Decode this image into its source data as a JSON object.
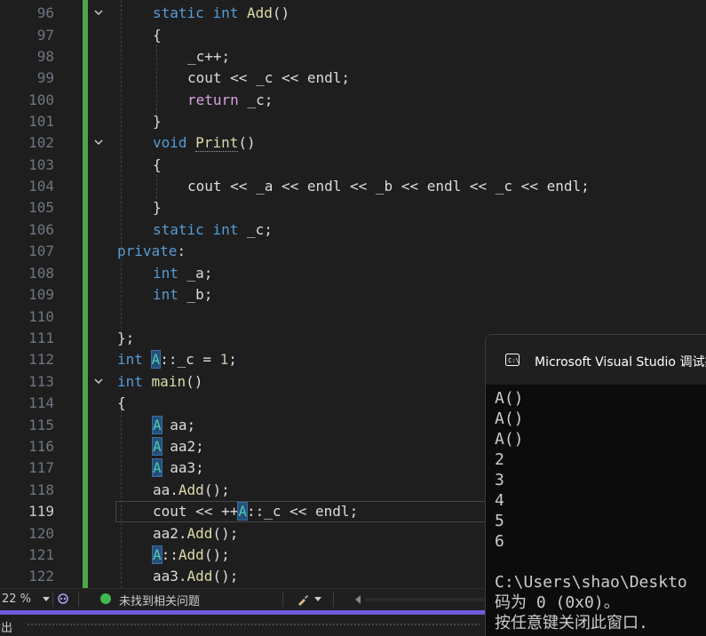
{
  "editor": {
    "lines": [
      {
        "n": "96"
      },
      {
        "n": "97"
      },
      {
        "n": "98"
      },
      {
        "n": "99"
      },
      {
        "n": "100"
      },
      {
        "n": "101"
      },
      {
        "n": "102"
      },
      {
        "n": "103"
      },
      {
        "n": "104"
      },
      {
        "n": "105"
      },
      {
        "n": "106"
      },
      {
        "n": "107"
      },
      {
        "n": "108"
      },
      {
        "n": "109"
      },
      {
        "n": "110"
      },
      {
        "n": "111"
      },
      {
        "n": "112"
      },
      {
        "n": "113"
      },
      {
        "n": "114"
      },
      {
        "n": "115"
      },
      {
        "n": "116"
      },
      {
        "n": "117"
      },
      {
        "n": "118"
      },
      {
        "n": "119"
      },
      {
        "n": "120"
      },
      {
        "n": "121"
      },
      {
        "n": "122"
      }
    ],
    "code": {
      "l96": {
        "kw1": "static",
        "kw2": "int",
        "fn": "Add",
        "rest": "()"
      },
      "l97": "{",
      "l98": "_c++;",
      "l99": {
        "a": "cout << _c << ",
        "b": "endl",
        ";": ";"
      },
      "l100": {
        "kw": "return",
        "rest": " _c;"
      },
      "l101": "}",
      "l102": {
        "kw": "void",
        "fn": "Print",
        "rest": "()"
      },
      "l103": "{",
      "l104": "cout << _a << endl << _b << endl << _c << endl;",
      "l105": "}",
      "l106": {
        "kw1": "static",
        "kw2": "int",
        "rest": " _c;"
      },
      "l107": {
        "kw": "private",
        "rest": ":"
      },
      "l108": {
        "kw": "int",
        "rest": " _a;"
      },
      "l109": {
        "kw": "int",
        "rest": " _b;"
      },
      "l111": "};",
      "l112": {
        "kw": "int",
        "cls": "A",
        "rest": "::_c = ",
        "num": "1",
        ";": ";"
      },
      "l113": {
        "kw": "int",
        "fn": "main",
        "rest": "()"
      },
      "l114": "{",
      "l115": {
        "cls": "A",
        "rest": " aa;"
      },
      "l116": {
        "cls": "A",
        "rest": " aa2;"
      },
      "l117": {
        "cls": "A",
        "rest": " aa3;"
      },
      "l118": {
        "pre": "aa.",
        "fn": "Add",
        "rest": "();"
      },
      "l119": {
        "pre": "cout << ++",
        "cls": "A",
        "rest": "::_c << endl;"
      },
      "l120": {
        "pre": "aa2.",
        "fn": "Add",
        "rest": "();"
      },
      "l121": {
        "cls": "A",
        "pre": "::",
        "fn": "Add",
        "rest": "();"
      },
      "l122": {
        "pre": "aa3.",
        "fn": "Add",
        "rest": "();"
      }
    }
  },
  "console": {
    "title": "Microsoft Visual Studio 调试控",
    "output": [
      "A()",
      "A()",
      "A()",
      "2",
      "3",
      "4",
      "5",
      "6",
      "",
      "C:\\Users\\shao\\Deskto",
      "码为 0 (0x0)。",
      "按任意键关闭此窗口. "
    ]
  },
  "status_bar": {
    "zoom": "22 %",
    "issues": "未找到相关问题"
  },
  "output_panel": {
    "label": "输出"
  },
  "colors": {
    "change_bar": "#4ea649",
    "accent": "#6f5ad8"
  }
}
